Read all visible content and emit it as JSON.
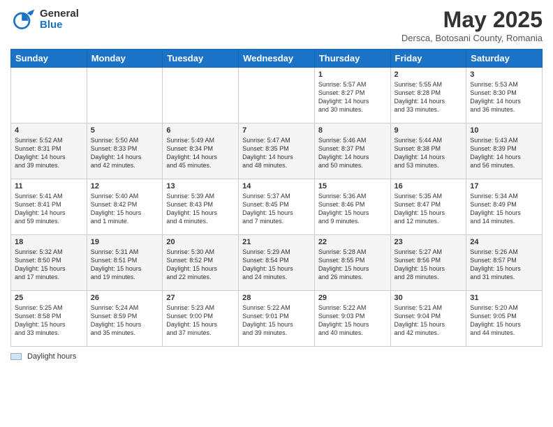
{
  "header": {
    "logo_general": "General",
    "logo_blue": "Blue",
    "title": "May 2025",
    "subtitle": "Dersca, Botosani County, Romania"
  },
  "days_of_week": [
    "Sunday",
    "Monday",
    "Tuesday",
    "Wednesday",
    "Thursday",
    "Friday",
    "Saturday"
  ],
  "weeks": [
    [
      {
        "day": "",
        "info": ""
      },
      {
        "day": "",
        "info": ""
      },
      {
        "day": "",
        "info": ""
      },
      {
        "day": "",
        "info": ""
      },
      {
        "day": "1",
        "info": "Sunrise: 5:57 AM\nSunset: 8:27 PM\nDaylight: 14 hours\nand 30 minutes."
      },
      {
        "day": "2",
        "info": "Sunrise: 5:55 AM\nSunset: 8:28 PM\nDaylight: 14 hours\nand 33 minutes."
      },
      {
        "day": "3",
        "info": "Sunrise: 5:53 AM\nSunset: 8:30 PM\nDaylight: 14 hours\nand 36 minutes."
      }
    ],
    [
      {
        "day": "4",
        "info": "Sunrise: 5:52 AM\nSunset: 8:31 PM\nDaylight: 14 hours\nand 39 minutes."
      },
      {
        "day": "5",
        "info": "Sunrise: 5:50 AM\nSunset: 8:33 PM\nDaylight: 14 hours\nand 42 minutes."
      },
      {
        "day": "6",
        "info": "Sunrise: 5:49 AM\nSunset: 8:34 PM\nDaylight: 14 hours\nand 45 minutes."
      },
      {
        "day": "7",
        "info": "Sunrise: 5:47 AM\nSunset: 8:35 PM\nDaylight: 14 hours\nand 48 minutes."
      },
      {
        "day": "8",
        "info": "Sunrise: 5:46 AM\nSunset: 8:37 PM\nDaylight: 14 hours\nand 50 minutes."
      },
      {
        "day": "9",
        "info": "Sunrise: 5:44 AM\nSunset: 8:38 PM\nDaylight: 14 hours\nand 53 minutes."
      },
      {
        "day": "10",
        "info": "Sunrise: 5:43 AM\nSunset: 8:39 PM\nDaylight: 14 hours\nand 56 minutes."
      }
    ],
    [
      {
        "day": "11",
        "info": "Sunrise: 5:41 AM\nSunset: 8:41 PM\nDaylight: 14 hours\nand 59 minutes."
      },
      {
        "day": "12",
        "info": "Sunrise: 5:40 AM\nSunset: 8:42 PM\nDaylight: 15 hours\nand 1 minute."
      },
      {
        "day": "13",
        "info": "Sunrise: 5:39 AM\nSunset: 8:43 PM\nDaylight: 15 hours\nand 4 minutes."
      },
      {
        "day": "14",
        "info": "Sunrise: 5:37 AM\nSunset: 8:45 PM\nDaylight: 15 hours\nand 7 minutes."
      },
      {
        "day": "15",
        "info": "Sunrise: 5:36 AM\nSunset: 8:46 PM\nDaylight: 15 hours\nand 9 minutes."
      },
      {
        "day": "16",
        "info": "Sunrise: 5:35 AM\nSunset: 8:47 PM\nDaylight: 15 hours\nand 12 minutes."
      },
      {
        "day": "17",
        "info": "Sunrise: 5:34 AM\nSunset: 8:49 PM\nDaylight: 15 hours\nand 14 minutes."
      }
    ],
    [
      {
        "day": "18",
        "info": "Sunrise: 5:32 AM\nSunset: 8:50 PM\nDaylight: 15 hours\nand 17 minutes."
      },
      {
        "day": "19",
        "info": "Sunrise: 5:31 AM\nSunset: 8:51 PM\nDaylight: 15 hours\nand 19 minutes."
      },
      {
        "day": "20",
        "info": "Sunrise: 5:30 AM\nSunset: 8:52 PM\nDaylight: 15 hours\nand 22 minutes."
      },
      {
        "day": "21",
        "info": "Sunrise: 5:29 AM\nSunset: 8:54 PM\nDaylight: 15 hours\nand 24 minutes."
      },
      {
        "day": "22",
        "info": "Sunrise: 5:28 AM\nSunset: 8:55 PM\nDaylight: 15 hours\nand 26 minutes."
      },
      {
        "day": "23",
        "info": "Sunrise: 5:27 AM\nSunset: 8:56 PM\nDaylight: 15 hours\nand 28 minutes."
      },
      {
        "day": "24",
        "info": "Sunrise: 5:26 AM\nSunset: 8:57 PM\nDaylight: 15 hours\nand 31 minutes."
      }
    ],
    [
      {
        "day": "25",
        "info": "Sunrise: 5:25 AM\nSunset: 8:58 PM\nDaylight: 15 hours\nand 33 minutes."
      },
      {
        "day": "26",
        "info": "Sunrise: 5:24 AM\nSunset: 8:59 PM\nDaylight: 15 hours\nand 35 minutes."
      },
      {
        "day": "27",
        "info": "Sunrise: 5:23 AM\nSunset: 9:00 PM\nDaylight: 15 hours\nand 37 minutes."
      },
      {
        "day": "28",
        "info": "Sunrise: 5:22 AM\nSunset: 9:01 PM\nDaylight: 15 hours\nand 39 minutes."
      },
      {
        "day": "29",
        "info": "Sunrise: 5:22 AM\nSunset: 9:03 PM\nDaylight: 15 hours\nand 40 minutes."
      },
      {
        "day": "30",
        "info": "Sunrise: 5:21 AM\nSunset: 9:04 PM\nDaylight: 15 hours\nand 42 minutes."
      },
      {
        "day": "31",
        "info": "Sunrise: 5:20 AM\nSunset: 9:05 PM\nDaylight: 15 hours\nand 44 minutes."
      }
    ]
  ],
  "legend": {
    "label": "Daylight hours"
  },
  "colors": {
    "header_bg": "#1a73c6",
    "row_odd": "#ffffff",
    "row_even": "#f5f5f5",
    "legend_box": "#cce5ff"
  }
}
